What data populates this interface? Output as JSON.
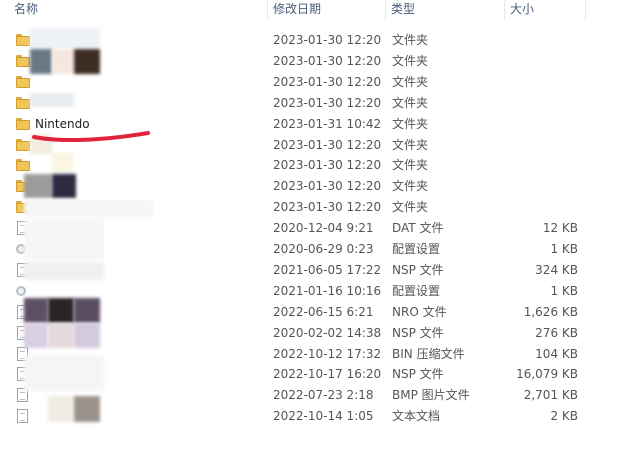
{
  "columns": {
    "name": "名称",
    "date": "修改日期",
    "type": "类型",
    "size": "大小"
  },
  "colors": {
    "folder": "#f0c55a",
    "redline": "#e0223a",
    "header_text": "#4a5a78"
  },
  "rows": [
    {
      "icon": "folder-icon",
      "name": "",
      "date": "2023-01-30 12:20",
      "type": "文件夹",
      "size": ""
    },
    {
      "icon": "folder-icon",
      "name": "",
      "date": "2023-01-30 12:20",
      "type": "文件夹",
      "size": ""
    },
    {
      "icon": "folder-icon",
      "name": "",
      "date": "2023-01-30 12:20",
      "type": "文件夹",
      "size": ""
    },
    {
      "icon": "folder-icon",
      "name": "",
      "date": "2023-01-30 12:20",
      "type": "文件夹",
      "size": ""
    },
    {
      "icon": "folder-icon",
      "name": "Nintendo",
      "date": "2023-01-31 10:42",
      "type": "文件夹",
      "size": ""
    },
    {
      "icon": "folder-icon",
      "name": "",
      "date": "2023-01-30 12:20",
      "type": "文件夹",
      "size": ""
    },
    {
      "icon": "folder-icon",
      "name": "",
      "date": "2023-01-30 12:20",
      "type": "文件夹",
      "size": ""
    },
    {
      "icon": "folder-icon",
      "name": "",
      "date": "2023-01-30 12:20",
      "type": "文件夹",
      "size": ""
    },
    {
      "icon": "folder-icon",
      "name": "",
      "date": "2023-01-30 12:20",
      "type": "文件夹",
      "size": ""
    },
    {
      "icon": "file-icon",
      "name": "",
      "date": "2020-12-04 9:21",
      "type": "DAT 文件",
      "size": "12 KB"
    },
    {
      "icon": "config-file-icon",
      "name": "",
      "date": "2020-06-29 0:23",
      "type": "配置设置",
      "size": "1 KB"
    },
    {
      "icon": "file-icon",
      "name": "",
      "date": "2021-06-05 17:22",
      "type": "NSP 文件",
      "size": "324 KB"
    },
    {
      "icon": "config-file-icon",
      "name": "",
      "date": "2021-01-16 10:16",
      "type": "配置设置",
      "size": "1 KB"
    },
    {
      "icon": "file-icon",
      "name": "",
      "date": "2022-06-15 6:21",
      "type": "NRO 文件",
      "size": "1,626 KB"
    },
    {
      "icon": "file-icon",
      "name": "",
      "date": "2020-02-02 14:38",
      "type": "NSP 文件",
      "size": "276 KB"
    },
    {
      "icon": "file-icon",
      "name": "",
      "date": "2022-10-12 17:32",
      "type": "BIN 压缩文件",
      "size": "104 KB"
    },
    {
      "icon": "file-icon",
      "name": "",
      "date": "2022-10-17 16:20",
      "type": "NSP 文件",
      "size": "16,079 KB"
    },
    {
      "icon": "file-icon",
      "name": "",
      "date": "2022-07-23 2:18",
      "type": "BMP 图片文件",
      "size": "2,701 KB"
    },
    {
      "icon": "file-icon",
      "name": "",
      "date": "2022-10-14 1:05",
      "type": "文本文档",
      "size": "2 KB"
    }
  ]
}
